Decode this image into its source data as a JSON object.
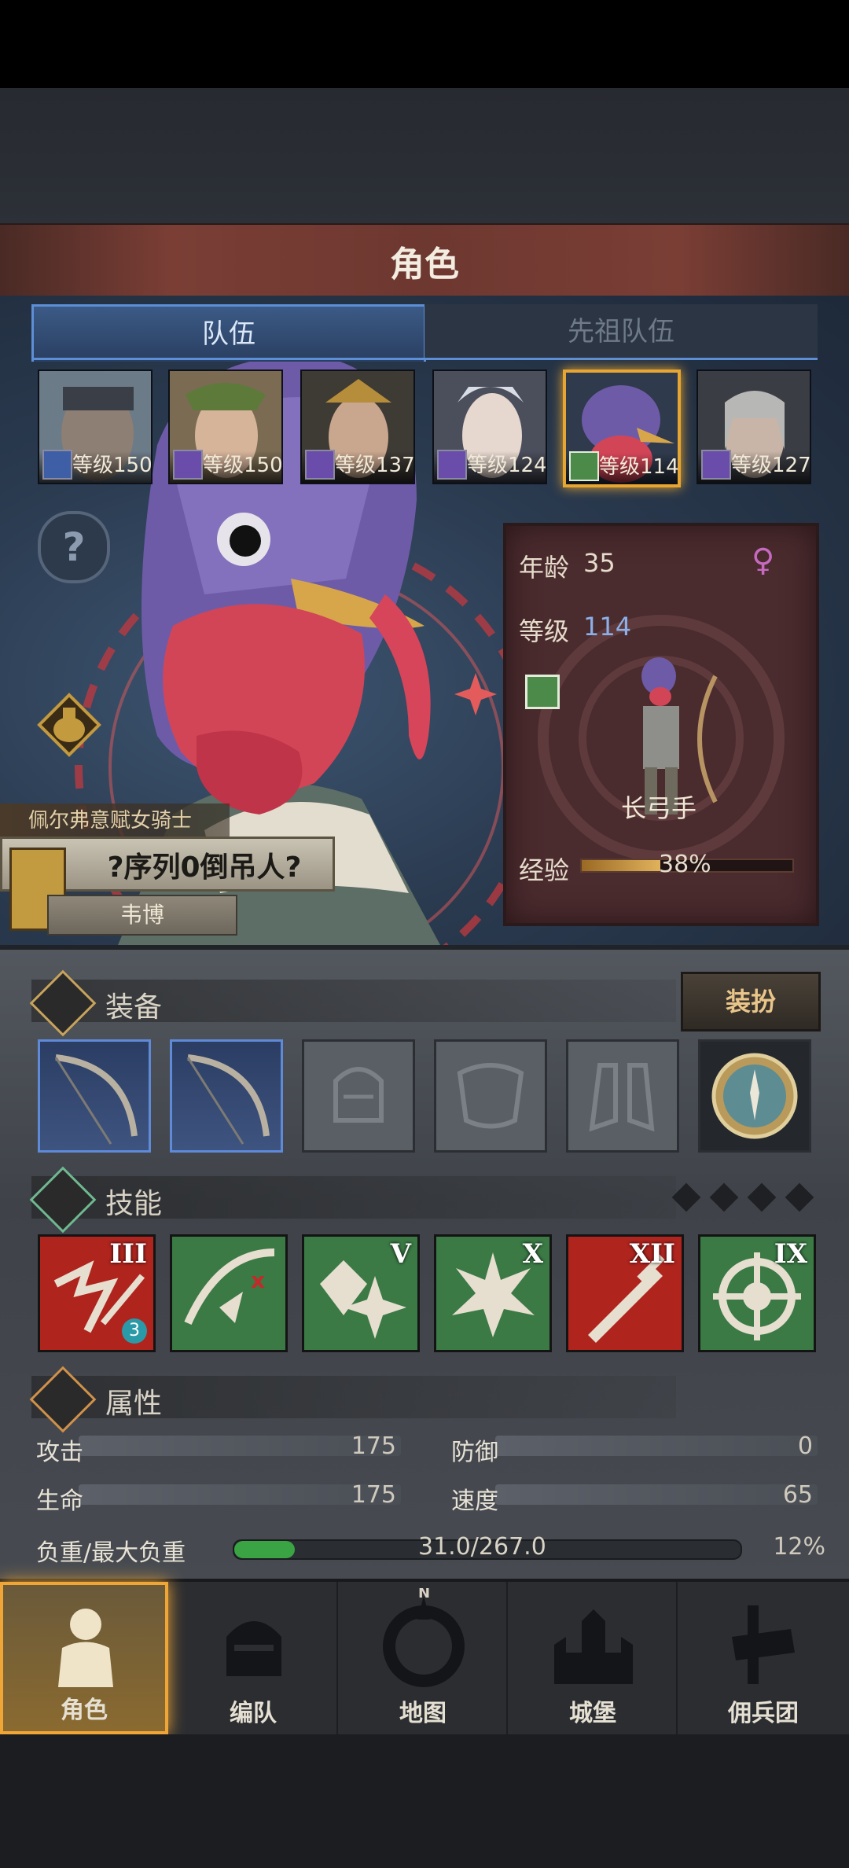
{
  "header": {
    "title": "角色"
  },
  "tabs": [
    {
      "label": "队伍",
      "active": true
    },
    {
      "label": "先祖队伍",
      "active": false
    }
  ],
  "roster": [
    {
      "level": "等级150",
      "class_icon": "sword-icon"
    },
    {
      "level": "等级150",
      "class_icon": "staff-icon"
    },
    {
      "level": "等级137",
      "class_icon": "staff-icon"
    },
    {
      "level": "等级124",
      "class_icon": "staff-icon"
    },
    {
      "level": "等级114",
      "class_icon": "bow-icon",
      "selected": true
    },
    {
      "level": "等级127",
      "class_icon": "staff-icon"
    }
  ],
  "character": {
    "house": "佩尔弗意赋女骑士",
    "name": "?序列0倒吊人?",
    "subtitle": "韦博",
    "age_label": "年龄",
    "age": "35",
    "level_label": "等级",
    "level": "114",
    "gender_icon": "female-icon",
    "class_name": "长弓手",
    "exp_label": "经验",
    "exp_percent_text": "38%",
    "exp_fraction": 0.38
  },
  "equipment": {
    "title": "装备",
    "dress_button": "装扮",
    "slots": [
      {
        "name": "bow-slot-1",
        "filled": true
      },
      {
        "name": "bow-slot-2",
        "filled": true
      },
      {
        "name": "helmet-slot",
        "filled": false
      },
      {
        "name": "armor-slot",
        "filled": false
      },
      {
        "name": "boots-slot",
        "filled": false
      },
      {
        "name": "trinket-slot",
        "filled": true
      }
    ]
  },
  "skills": {
    "title": "技能",
    "items": [
      {
        "rank": "III",
        "color": "#b0241e",
        "badge": "3"
      },
      {
        "rank": "",
        "color": "#3b7a45"
      },
      {
        "rank": "V",
        "color": "#3b7a45"
      },
      {
        "rank": "X",
        "color": "#3b7a45"
      },
      {
        "rank": "XII",
        "color": "#b0241e"
      },
      {
        "rank": "IX",
        "color": "#3b7a45"
      }
    ]
  },
  "attributes": {
    "title": "属性",
    "attack_label": "攻击",
    "attack": "175",
    "defense_label": "防御",
    "defense": "0",
    "hp_label": "生命",
    "hp": "175",
    "speed_label": "速度",
    "speed": "65",
    "load_label": "负重/最大负重",
    "load": "31.0/267.0",
    "load_percent": "12%",
    "load_fraction": 0.12
  },
  "nav": [
    {
      "label": "角色",
      "icon": "knight-icon",
      "active": true
    },
    {
      "label": "编队",
      "icon": "helmet-icon",
      "active": false
    },
    {
      "label": "地图",
      "icon": "compass-icon",
      "active": false
    },
    {
      "label": "城堡",
      "icon": "castle-icon",
      "active": false
    },
    {
      "label": "佣兵团",
      "icon": "mercenary-icon",
      "active": false
    }
  ]
}
